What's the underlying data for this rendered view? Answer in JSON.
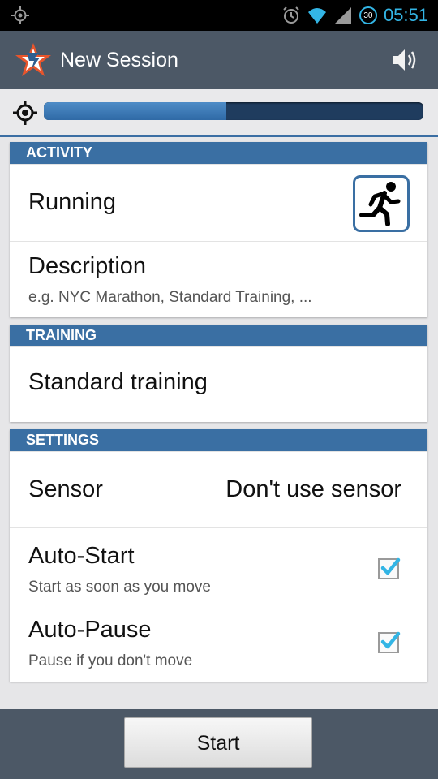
{
  "status_bar": {
    "time": "05:51",
    "battery_level": "30"
  },
  "action_bar": {
    "title": "New Session",
    "logo_icon": "star-logo-icon",
    "sound_icon": "speaker-icon"
  },
  "gps": {
    "signal_fraction": 0.48
  },
  "activity": {
    "header": "ACTIVITY",
    "sport": "Running",
    "sport_icon": "running-icon",
    "description_label": "Description",
    "description_placeholder": "e.g. NYC Marathon, Standard Training, ..."
  },
  "training": {
    "header": "TRAINING",
    "value": "Standard training"
  },
  "settings": {
    "header": "SETTINGS",
    "sensor_label": "Sensor",
    "sensor_value": "Don't use sensor",
    "auto_start_label": "Auto-Start",
    "auto_start_desc": "Start as soon as you move",
    "auto_start_checked": true,
    "auto_pause_label": "Auto-Pause",
    "auto_pause_desc": "Pause if you don't move",
    "auto_pause_checked": true
  },
  "start_button": "Start",
  "colors": {
    "accent": "#3a6fa3",
    "bar": "#4c5866",
    "status_blue": "#33b5e5"
  }
}
